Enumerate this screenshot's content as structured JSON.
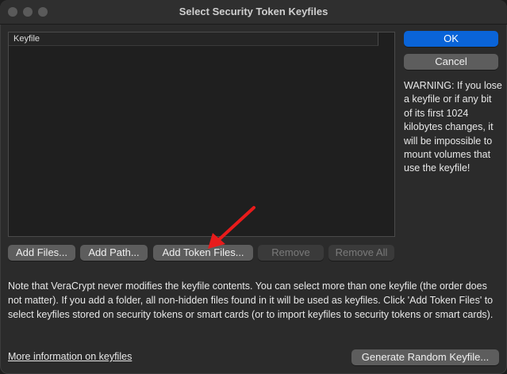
{
  "window": {
    "title": "Select Security Token Keyfiles"
  },
  "list": {
    "column_header": "Keyfile"
  },
  "buttons": {
    "ok": "OK",
    "cancel": "Cancel",
    "add_files": "Add Files...",
    "add_path": "Add Path...",
    "add_token_files": "Add Token Files...",
    "remove": "Remove",
    "remove_all": "Remove All",
    "generate_random_keyfile": "Generate Random Keyfile..."
  },
  "warning_text": "WARNING: If you lose a keyfile or if any bit of its first 1024 kilobytes changes, it will be impossible to mount volumes that use the keyfile!",
  "note_text": "Note that VeraCrypt never modifies the keyfile contents. You can select more than one keyfile (the order does not matter). If you add a folder, all non-hidden files found in it will be used as keyfiles. Click 'Add Token Files' to select keyfiles stored on security tokens or smart cards (or to import keyfiles to security tokens or smart cards).",
  "link_text": "More information on keyfiles",
  "colors": {
    "accent": "#0a64d8",
    "annotation_arrow": "#e81b1b"
  },
  "icons": {
    "annotation": "red-arrow-icon"
  }
}
